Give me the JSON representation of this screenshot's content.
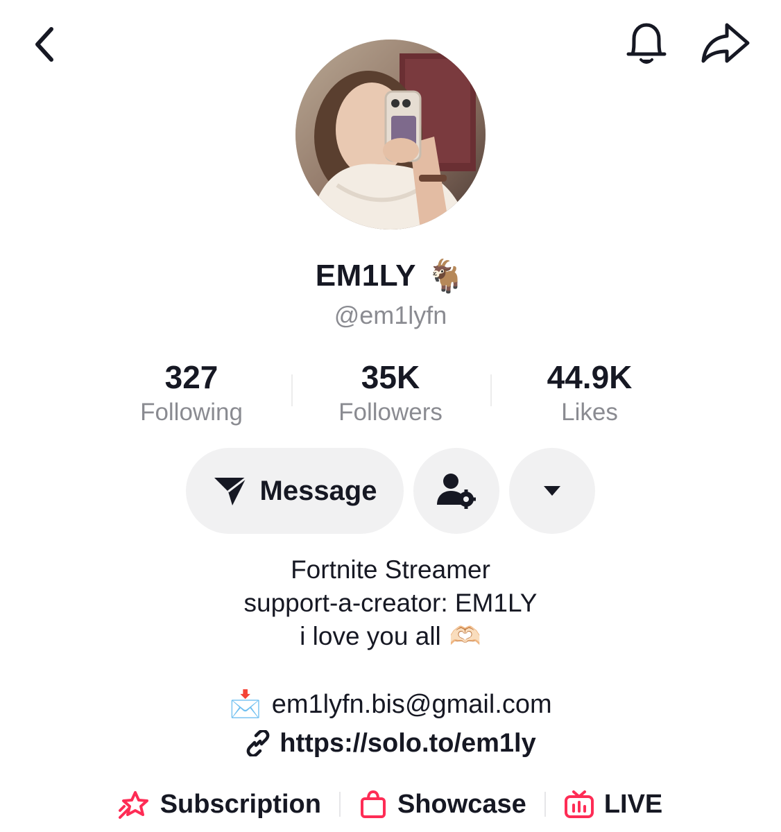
{
  "profile": {
    "display_name": "EM1LY",
    "display_name_emoji": "🐐",
    "username": "@em1lyfn"
  },
  "stats": {
    "following": {
      "value": "327",
      "label": "Following"
    },
    "followers": {
      "value": "35K",
      "label": "Followers"
    },
    "likes": {
      "value": "44.9K",
      "label": "Likes"
    }
  },
  "actions": {
    "message_label": "Message"
  },
  "bio": {
    "line1": "Fortnite Streamer",
    "line2": "support-a-creator: EM1LY",
    "line3": "i love you all",
    "line3_emoji": "🫶🏻",
    "email_emoji": "📩",
    "email": "em1lyfn.bis@gmail.com",
    "link": "https://solo.to/em1ly"
  },
  "tabs": [
    {
      "label": "Subscription",
      "icon": "subscription-star-icon"
    },
    {
      "label": "Showcase",
      "icon": "shopping-bag-icon"
    },
    {
      "label": "LIVE",
      "icon": "live-tv-icon"
    }
  ],
  "colors": {
    "text": "#161823",
    "secondary_text": "#8a8b91",
    "button_bg": "#f1f1f2",
    "accent": "#fe2c55"
  }
}
